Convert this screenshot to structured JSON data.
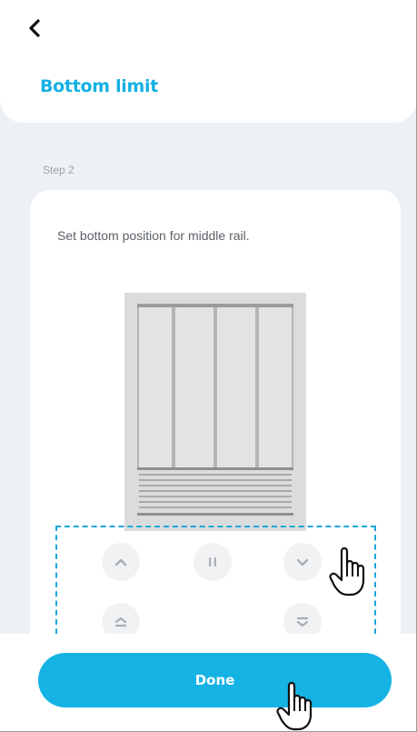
{
  "header": {
    "back_icon": "chevron-left-icon",
    "title": "Bottom limit"
  },
  "step": {
    "label": "Step 2"
  },
  "card": {
    "instruction": "Set bottom position for middle rail."
  },
  "controls": {
    "up_icon": "chevron-up-icon",
    "pause_icon": "pause-icon",
    "down_icon": "chevron-down-icon",
    "move_to_top_icon": "move-to-top-icon",
    "move_to_bottom_icon": "move-to-bottom-icon"
  },
  "footer": {
    "done_label": "Done"
  },
  "colors": {
    "accent": "#15b3e4",
    "title": "#15b0e3",
    "highlight": "#1ba7d9"
  }
}
